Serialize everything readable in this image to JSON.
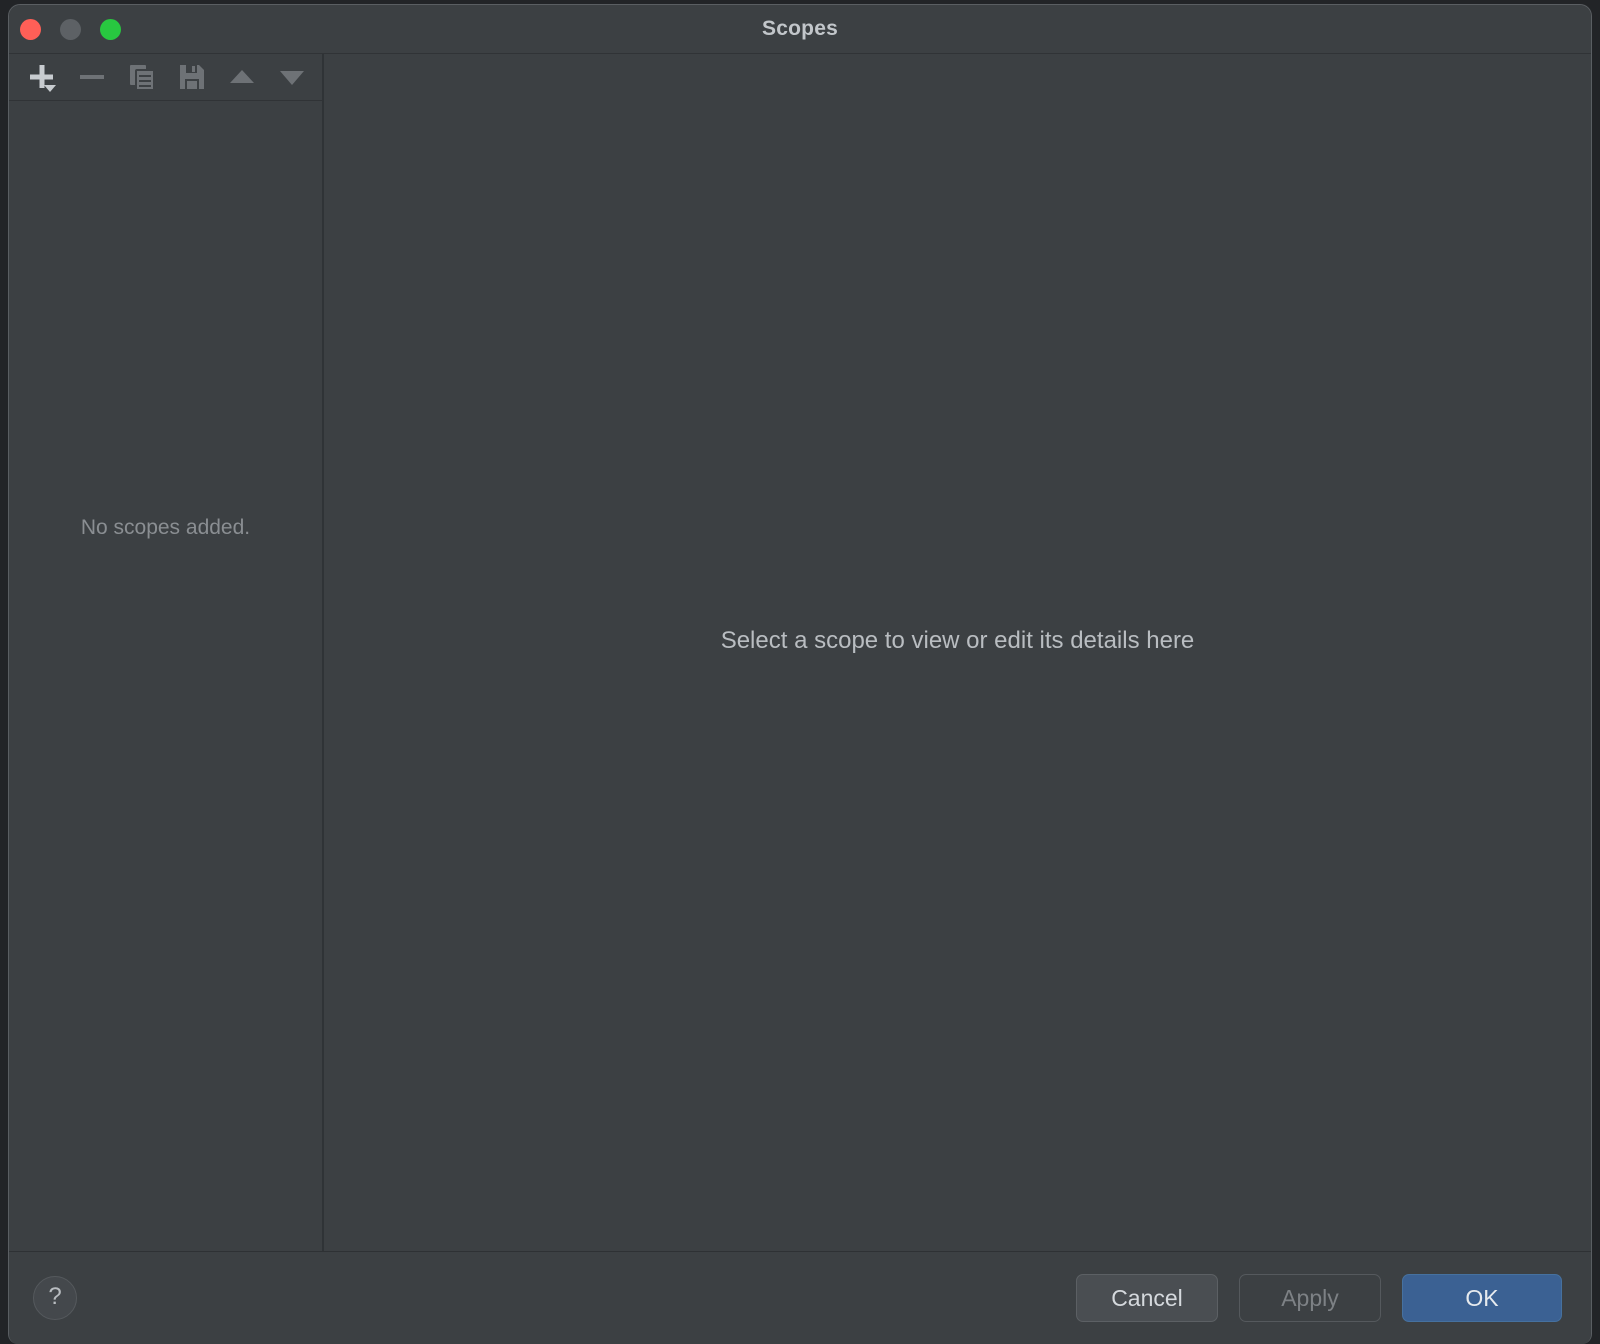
{
  "window": {
    "title": "Scopes",
    "traffic_lights": [
      {
        "name": "close",
        "color": "#ff5f57"
      },
      {
        "name": "minimize",
        "color": "#5d6165"
      },
      {
        "name": "maximize",
        "color": "#28c840"
      }
    ]
  },
  "toolbar": {
    "buttons": [
      {
        "icon": "add-icon",
        "label": "Add scope",
        "enabled": true
      },
      {
        "icon": "remove-icon",
        "label": "Remove scope",
        "enabled": false
      },
      {
        "icon": "copy-icon",
        "label": "Duplicate scope",
        "enabled": false
      },
      {
        "icon": "save-icon",
        "label": "Save scope",
        "enabled": false
      },
      {
        "icon": "move-up-icon",
        "label": "Move up",
        "enabled": false
      },
      {
        "icon": "move-down-icon",
        "label": "Move down",
        "enabled": false
      }
    ]
  },
  "sidebar": {
    "empty_text": "No scopes added."
  },
  "main": {
    "placeholder": "Select a scope to view or edit its details here"
  },
  "footer": {
    "help_label": "?",
    "cancel_label": "Cancel",
    "apply_label": "Apply",
    "ok_label": "OK"
  },
  "colors": {
    "background": "#3c4043",
    "accent": "#3b6193",
    "text_primary": "#c2c6ca",
    "text_muted": "#8a8e92",
    "icon_enabled": "#c8ccd0",
    "icon_disabled": "#6e7276"
  }
}
